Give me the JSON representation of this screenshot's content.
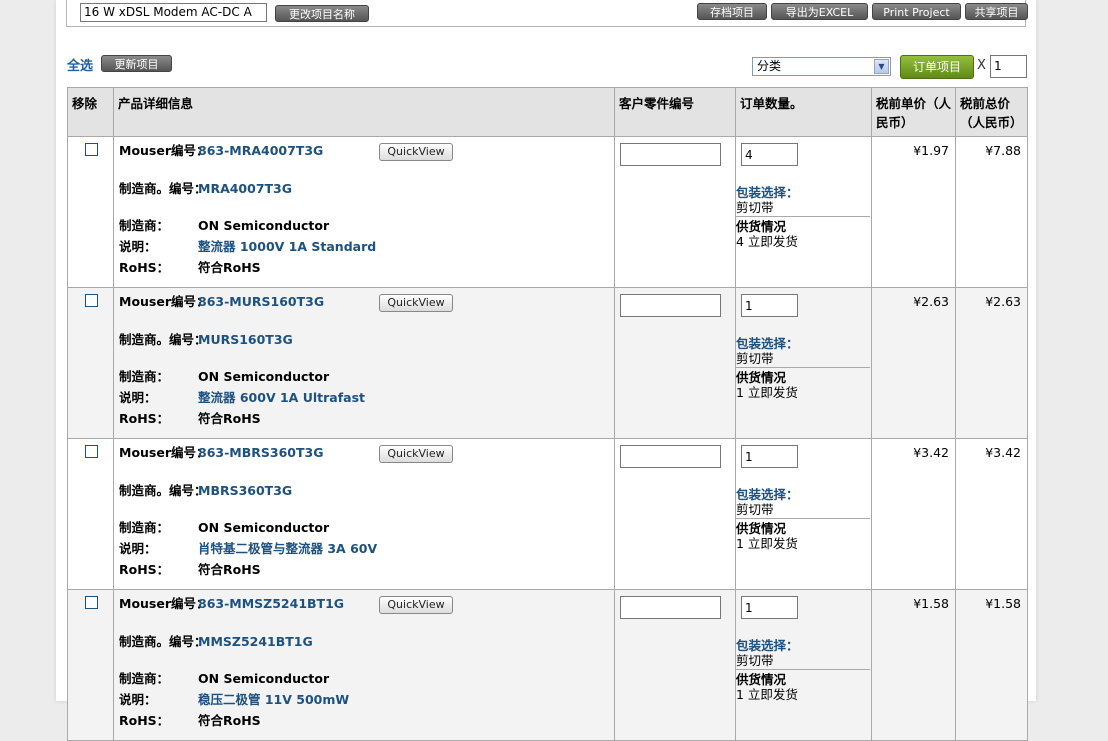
{
  "top": {
    "project_name": "16 W xDSL Modem AC-DC A",
    "rename_btn": "更改项目名称",
    "save_btn": "存档项目",
    "export_btn": "导出为EXCEL",
    "print_btn": "Print Project",
    "share_btn": "共享项目"
  },
  "toolbar": {
    "select_all": "全选",
    "update_btn": "更新项目",
    "category_select": "分类",
    "order_btn": "订单项目",
    "times": "X",
    "qty": "1"
  },
  "table": {
    "headers": {
      "remove": "移除",
      "details": "产品详细信息",
      "customer_pn": "客户零件编号",
      "order_qty": "订单数量。",
      "unit_price": "税前单价（人民币）",
      "total_price": "税前总价（人民币）"
    },
    "labels": {
      "mouser_no": "Mouser编号：",
      "mfr_no": "制造商。编号：",
      "mfr": "制造商：",
      "desc": "说明：",
      "rohs": "RoHS：",
      "quickview": "QuickView",
      "packaging": "包装选择：",
      "availability": "供货情况"
    },
    "rows": [
      {
        "mouser_no": "863-MRA4007T3G",
        "mfr_no": "MRA4007T3G",
        "mfr": "ON Semiconductor",
        "desc": "整流器 1000V 1A Standard",
        "rohs": "符合RoHS",
        "qty": "4",
        "packaging": "剪切带",
        "availability": "4 立即发货",
        "unit": "¥1.97",
        "total": "¥7.88"
      },
      {
        "mouser_no": "863-MURS160T3G",
        "mfr_no": "MURS160T3G",
        "mfr": "ON Semiconductor",
        "desc": "整流器 600V 1A Ultrafast",
        "rohs": "符合RoHS",
        "qty": "1",
        "packaging": "剪切带",
        "availability": "1 立即发货",
        "unit": "¥2.63",
        "total": "¥2.63"
      },
      {
        "mouser_no": "863-MBRS360T3G",
        "mfr_no": "MBRS360T3G",
        "mfr": "ON Semiconductor",
        "desc": "肖特基二极管与整流器 3A 60V",
        "rohs": "符合RoHS",
        "qty": "1",
        "packaging": "剪切带",
        "availability": "1 立即发货",
        "unit": "¥3.42",
        "total": "¥3.42"
      },
      {
        "mouser_no": "863-MMSZ5241BT1G",
        "mfr_no": "MMSZ5241BT1G",
        "mfr": "ON Semiconductor",
        "desc": "稳压二极管 11V 500mW",
        "rohs": "符合RoHS",
        "qty": "1",
        "packaging": "剪切带",
        "availability": "1 立即发货",
        "unit": "¥1.58",
        "total": "¥1.58"
      }
    ]
  }
}
